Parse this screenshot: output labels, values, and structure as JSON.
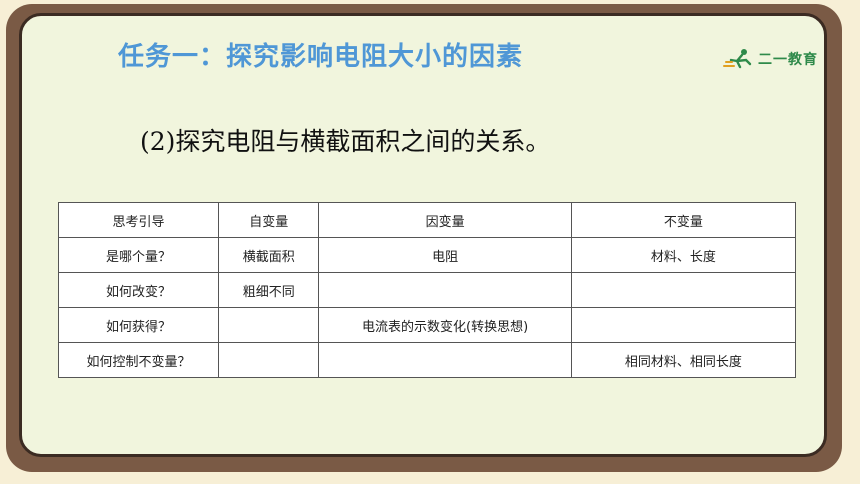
{
  "title": "任务一：探究影响电阻大小的因素",
  "logo": {
    "text": "二一教育"
  },
  "subtitle": "(2)探究电阻与横截面积之间的关系。",
  "table": {
    "headers": [
      "思考引导",
      "自变量",
      "因变量",
      "不变量"
    ],
    "rows": [
      [
        "是哪个量？",
        "横截面积",
        "电阻",
        "材料、长度"
      ],
      [
        "如何改变？",
        "粗细不同",
        "",
        ""
      ],
      [
        "如何获得？",
        "",
        "电流表的示数变化(转换思想)",
        ""
      ],
      [
        "如何控制不变量？",
        "",
        "",
        "相同材料、相同长度"
      ]
    ]
  },
  "colors": {
    "title": "#4f97d6",
    "frame": "#7a5a45",
    "board": "#f1f5dd",
    "logo": "#2f8a4a"
  }
}
